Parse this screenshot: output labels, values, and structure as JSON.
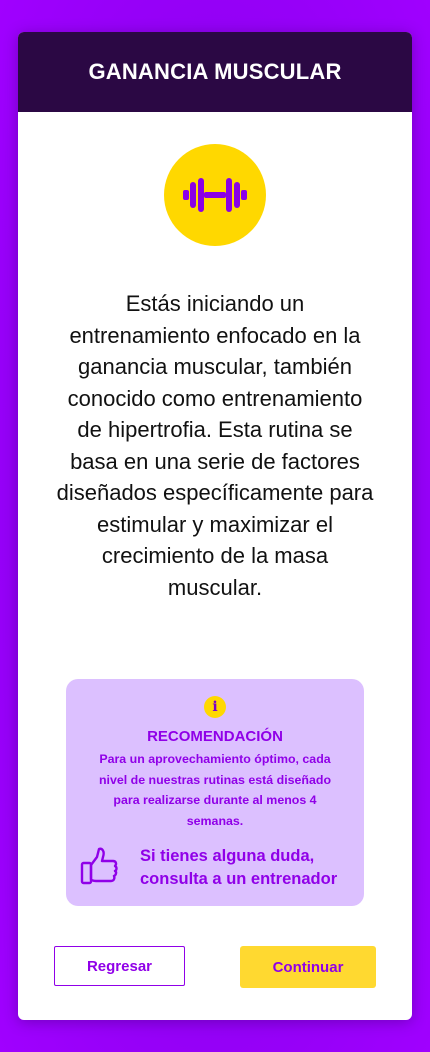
{
  "header": {
    "title": "GANANCIA MUSCULAR"
  },
  "icons": {
    "hero": "dumbbell-icon",
    "info": "info-icon",
    "contact": "thumbs-up-icon"
  },
  "intro": {
    "text": "Estás iniciando un entrenamiento enfocado en la ganancia muscular, también conocido como entrenamiento de hipertrofia. Esta rutina se basa en una serie de factores diseñados específicamente para estimular y maximizar el crecimiento de la masa muscular."
  },
  "recommendation": {
    "info_glyph": "i",
    "title": "RECOMENDACIÓN",
    "text": "Para un aprovechamiento óptimo, cada nivel de nuestras rutinas está diseñado para realizarse durante al menos 4 semanas.",
    "contact": "Si tienes alguna duda, consulta a un entrenador"
  },
  "buttons": {
    "back": "Regresar",
    "next": "Continuar"
  },
  "colors": {
    "background": "#9000f0",
    "header": "#2b0844",
    "accent": "#9000e8",
    "yellow": "#ffd800",
    "recommendation_bg": "#dcc0ff"
  }
}
